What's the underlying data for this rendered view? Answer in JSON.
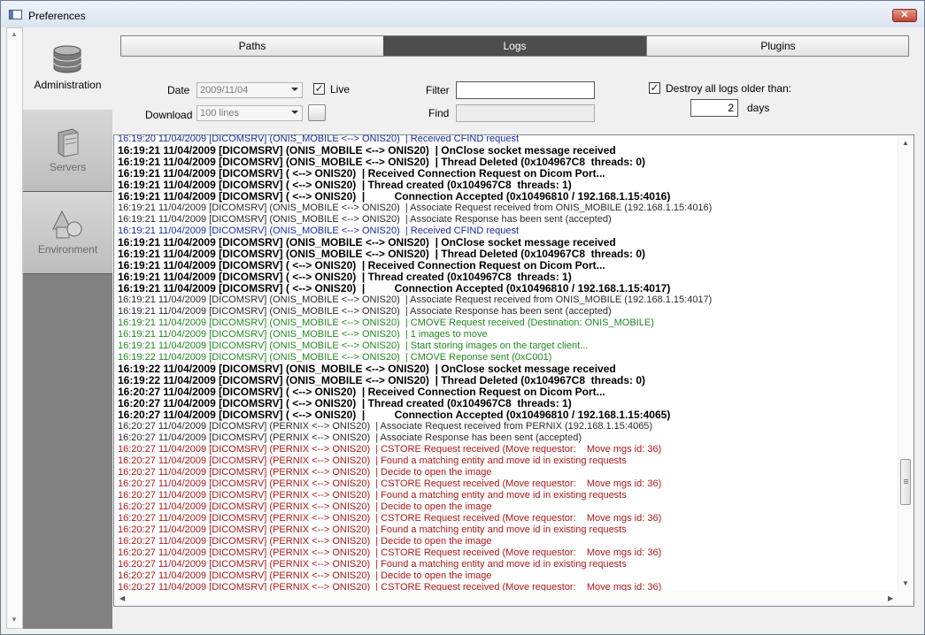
{
  "window": {
    "title": "Preferences",
    "close_label": "✕"
  },
  "sidebar": {
    "items": [
      {
        "label": "Administration",
        "active": true
      },
      {
        "label": "Servers",
        "active": false
      },
      {
        "label": "Environment",
        "active": false
      }
    ]
  },
  "tabs": [
    {
      "label": "Paths",
      "selected": false
    },
    {
      "label": "Logs",
      "selected": true
    },
    {
      "label": "Plugins",
      "selected": false
    }
  ],
  "controls": {
    "date_label": "Date",
    "date_value": "2009/11/04",
    "live_label": "Live",
    "live_checked": true,
    "download_label": "Download",
    "download_value": "100 lines",
    "filter_label": "Filter",
    "filter_value": "",
    "find_label": "Find",
    "find_value": "",
    "destroy_label": "Destroy all logs older than:",
    "destroy_checked": true,
    "days_value": "2",
    "days_label": "days"
  },
  "colors": {
    "blue": "#1a2aa8",
    "green": "#208a20",
    "red": "#b01818",
    "tab_selected": "#4d4d4d"
  },
  "log_lines": [
    {
      "text": "16:19:20 11/04/2009 [DICOMSRV] (ONIS_MOBILE <--> ONIS20)  | Received CFIND request",
      "style": "blue"
    },
    {
      "text": "16:19:21 11/04/2009 [DICOMSRV] (ONIS_MOBILE <--> ONIS20)  | OnClose socket message received",
      "style": "bold"
    },
    {
      "text": "16:19:21 11/04/2009 [DICOMSRV] (ONIS_MOBILE <--> ONIS20)  | Thread Deleted (0x104967C8  threads: 0)",
      "style": "bold"
    },
    {
      "text": "16:19:21 11/04/2009 [DICOMSRV] ( <--> ONIS20)  | Received Connection Request on Dicom Port...",
      "style": "bold"
    },
    {
      "text": "16:19:21 11/04/2009 [DICOMSRV] ( <--> ONIS20)  | Thread created (0x104967C8  threads: 1)",
      "style": "bold"
    },
    {
      "text": "16:19:21 11/04/2009 [DICOMSRV] ( <--> ONIS20)  |          Connection Accepted (0x10496810 / 192.168.1.15:4016)",
      "style": "bold"
    },
    {
      "text": "16:19:21 11/04/2009 [DICOMSRV] (ONIS_MOBILE <--> ONIS20)  | Associate Request received from ONIS_MOBILE (192.168.1.15:4016)",
      "style": "gray"
    },
    {
      "text": "16:19:21 11/04/2009 [DICOMSRV] (ONIS_MOBILE <--> ONIS20)  | Associate Response has been sent (accepted)",
      "style": "gray"
    },
    {
      "text": "16:19:21 11/04/2009 [DICOMSRV] (ONIS_MOBILE <--> ONIS20)  | Received CFIND request",
      "style": "blue"
    },
    {
      "text": "16:19:21 11/04/2009 [DICOMSRV] (ONIS_MOBILE <--> ONIS20)  | OnClose socket message received",
      "style": "bold"
    },
    {
      "text": "16:19:21 11/04/2009 [DICOMSRV] (ONIS_MOBILE <--> ONIS20)  | Thread Deleted (0x104967C8  threads: 0)",
      "style": "bold"
    },
    {
      "text": "16:19:21 11/04/2009 [DICOMSRV] ( <--> ONIS20)  | Received Connection Request on Dicom Port...",
      "style": "bold"
    },
    {
      "text": "16:19:21 11/04/2009 [DICOMSRV] ( <--> ONIS20)  | Thread created (0x104967C8  threads: 1)",
      "style": "bold"
    },
    {
      "text": "16:19:21 11/04/2009 [DICOMSRV] ( <--> ONIS20)  |          Connection Accepted (0x10496810 / 192.168.1.15:4017)",
      "style": "bold"
    },
    {
      "text": "16:19:21 11/04/2009 [DICOMSRV] (ONIS_MOBILE <--> ONIS20)  | Associate Request received from ONIS_MOBILE (192.168.1.15:4017)",
      "style": "gray"
    },
    {
      "text": "16:19:21 11/04/2009 [DICOMSRV] (ONIS_MOBILE <--> ONIS20)  | Associate Response has been sent (accepted)",
      "style": "gray"
    },
    {
      "text": "16:19:21 11/04/2009 [DICOMSRV] (ONIS_MOBILE <--> ONIS20)  | CMOVE Request received (Destination: ONIS_MOBILE)",
      "style": "green"
    },
    {
      "text": "16:19:21 11/04/2009 [DICOMSRV] (ONIS_MOBILE <--> ONIS20)  | 1 images to move",
      "style": "green"
    },
    {
      "text": "16:19:21 11/04/2009 [DICOMSRV] (ONIS_MOBILE <--> ONIS20)  | Start storing images on the target client...",
      "style": "green"
    },
    {
      "text": "16:19:22 11/04/2009 [DICOMSRV] (ONIS_MOBILE <--> ONIS20)  | CMOVE Reponse sent (0xC001)",
      "style": "green"
    },
    {
      "text": "16:19:22 11/04/2009 [DICOMSRV] (ONIS_MOBILE <--> ONIS20)  | OnClose socket message received",
      "style": "bold"
    },
    {
      "text": "16:19:22 11/04/2009 [DICOMSRV] (ONIS_MOBILE <--> ONIS20)  | Thread Deleted (0x104967C8  threads: 0)",
      "style": "bold"
    },
    {
      "text": "16:20:27 11/04/2009 [DICOMSRV] ( <--> ONIS20)  | Received Connection Request on Dicom Port...",
      "style": "bold"
    },
    {
      "text": "16:20:27 11/04/2009 [DICOMSRV] ( <--> ONIS20)  | Thread created (0x104967C8  threads: 1)",
      "style": "bold"
    },
    {
      "text": "16:20:27 11/04/2009 [DICOMSRV] ( <--> ONIS20)  |          Connection Accepted (0x10496810 / 192.168.1.15:4065)",
      "style": "bold"
    },
    {
      "text": "16:20:27 11/04/2009 [DICOMSRV] (PERNIX <--> ONIS20)  | Associate Request received from PERNIX (192.168.1.15:4065)",
      "style": "gray"
    },
    {
      "text": "16:20:27 11/04/2009 [DICOMSRV] (PERNIX <--> ONIS20)  | Associate Response has been sent (accepted)",
      "style": "gray"
    },
    {
      "text": "16:20:27 11/04/2009 [DICOMSRV] (PERNIX <--> ONIS20)  | CSTORE Request received (Move requestor:    Move mgs id: 36)",
      "style": "red"
    },
    {
      "text": "16:20:27 11/04/2009 [DICOMSRV] (PERNIX <--> ONIS20)  | Found a matching entity and move id in existing requests",
      "style": "red"
    },
    {
      "text": "16:20:27 11/04/2009 [DICOMSRV] (PERNIX <--> ONIS20)  | Decide to open the image",
      "style": "red"
    },
    {
      "text": "16:20:27 11/04/2009 [DICOMSRV] (PERNIX <--> ONIS20)  | CSTORE Request received (Move requestor:    Move mgs id: 36)",
      "style": "red"
    },
    {
      "text": "16:20:27 11/04/2009 [DICOMSRV] (PERNIX <--> ONIS20)  | Found a matching entity and move id in existing requests",
      "style": "red"
    },
    {
      "text": "16:20:27 11/04/2009 [DICOMSRV] (PERNIX <--> ONIS20)  | Decide to open the image",
      "style": "red"
    },
    {
      "text": "16:20:27 11/04/2009 [DICOMSRV] (PERNIX <--> ONIS20)  | CSTORE Request received (Move requestor:    Move mgs id: 36)",
      "style": "red"
    },
    {
      "text": "16:20:27 11/04/2009 [DICOMSRV] (PERNIX <--> ONIS20)  | Found a matching entity and move id in existing requests",
      "style": "red"
    },
    {
      "text": "16:20:27 11/04/2009 [DICOMSRV] (PERNIX <--> ONIS20)  | Decide to open the image",
      "style": "red"
    },
    {
      "text": "16:20:27 11/04/2009 [DICOMSRV] (PERNIX <--> ONIS20)  | CSTORE Request received (Move requestor:    Move mgs id: 36)",
      "style": "red"
    },
    {
      "text": "16:20:27 11/04/2009 [DICOMSRV] (PERNIX <--> ONIS20)  | Found a matching entity and move id in existing requests",
      "style": "red"
    },
    {
      "text": "16:20:27 11/04/2009 [DICOMSRV] (PERNIX <--> ONIS20)  | Decide to open the image",
      "style": "red"
    },
    {
      "text": "16:20:27 11/04/2009 [DICOMSRV] (PERNIX <--> ONIS20)  | CSTORE Request received (Move requestor:    Move mgs id: 36)",
      "style": "red"
    }
  ],
  "icons": {
    "window": "app-window-icon",
    "close": "close-icon",
    "administration": "database-icon",
    "servers": "server-icon",
    "environment": "shapes-icon"
  }
}
